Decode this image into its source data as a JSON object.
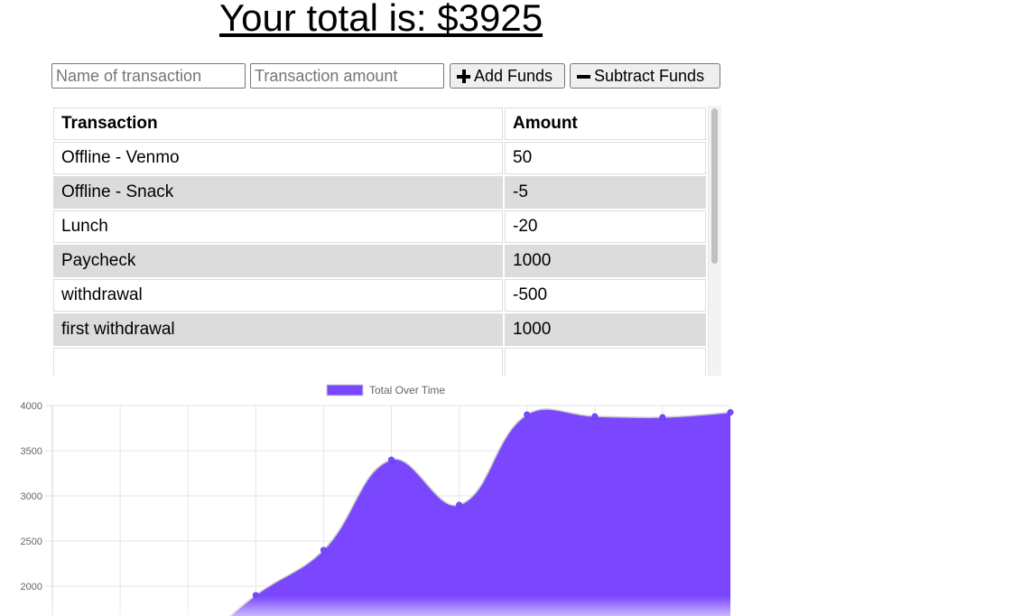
{
  "header": {
    "total_text": "Your total is: $3925"
  },
  "form": {
    "name_placeholder": "Name of transaction",
    "amount_placeholder": "Transaction amount",
    "add_label": "Add Funds",
    "subtract_label": "Subtract Funds"
  },
  "table": {
    "headers": [
      "Transaction",
      "Amount"
    ],
    "rows": [
      {
        "name": "Offline - Venmo",
        "amount": "50"
      },
      {
        "name": "Offline - Snack",
        "amount": "-5"
      },
      {
        "name": "Lunch",
        "amount": "-20"
      },
      {
        "name": "Paycheck",
        "amount": "1000"
      },
      {
        "name": "withdrawal",
        "amount": "-500"
      },
      {
        "name": "first withdrawal",
        "amount": "1000"
      }
    ]
  },
  "chart_data": {
    "type": "area",
    "series": [
      {
        "name": "Total Over Time",
        "color": "#7a47ff",
        "values": [
          null,
          null,
          null,
          1900,
          2400,
          3400,
          2900,
          3900,
          3880,
          3870,
          3925
        ]
      }
    ],
    "y_ticks": [
      "4000",
      "3500",
      "3000",
      "2500",
      "2000"
    ],
    "ylim": [
      1750,
      4000
    ],
    "grid": true,
    "legend": "top-center"
  },
  "colors": {
    "area_fill": "#7a47ff",
    "row_alt": "#dcdcdc"
  }
}
